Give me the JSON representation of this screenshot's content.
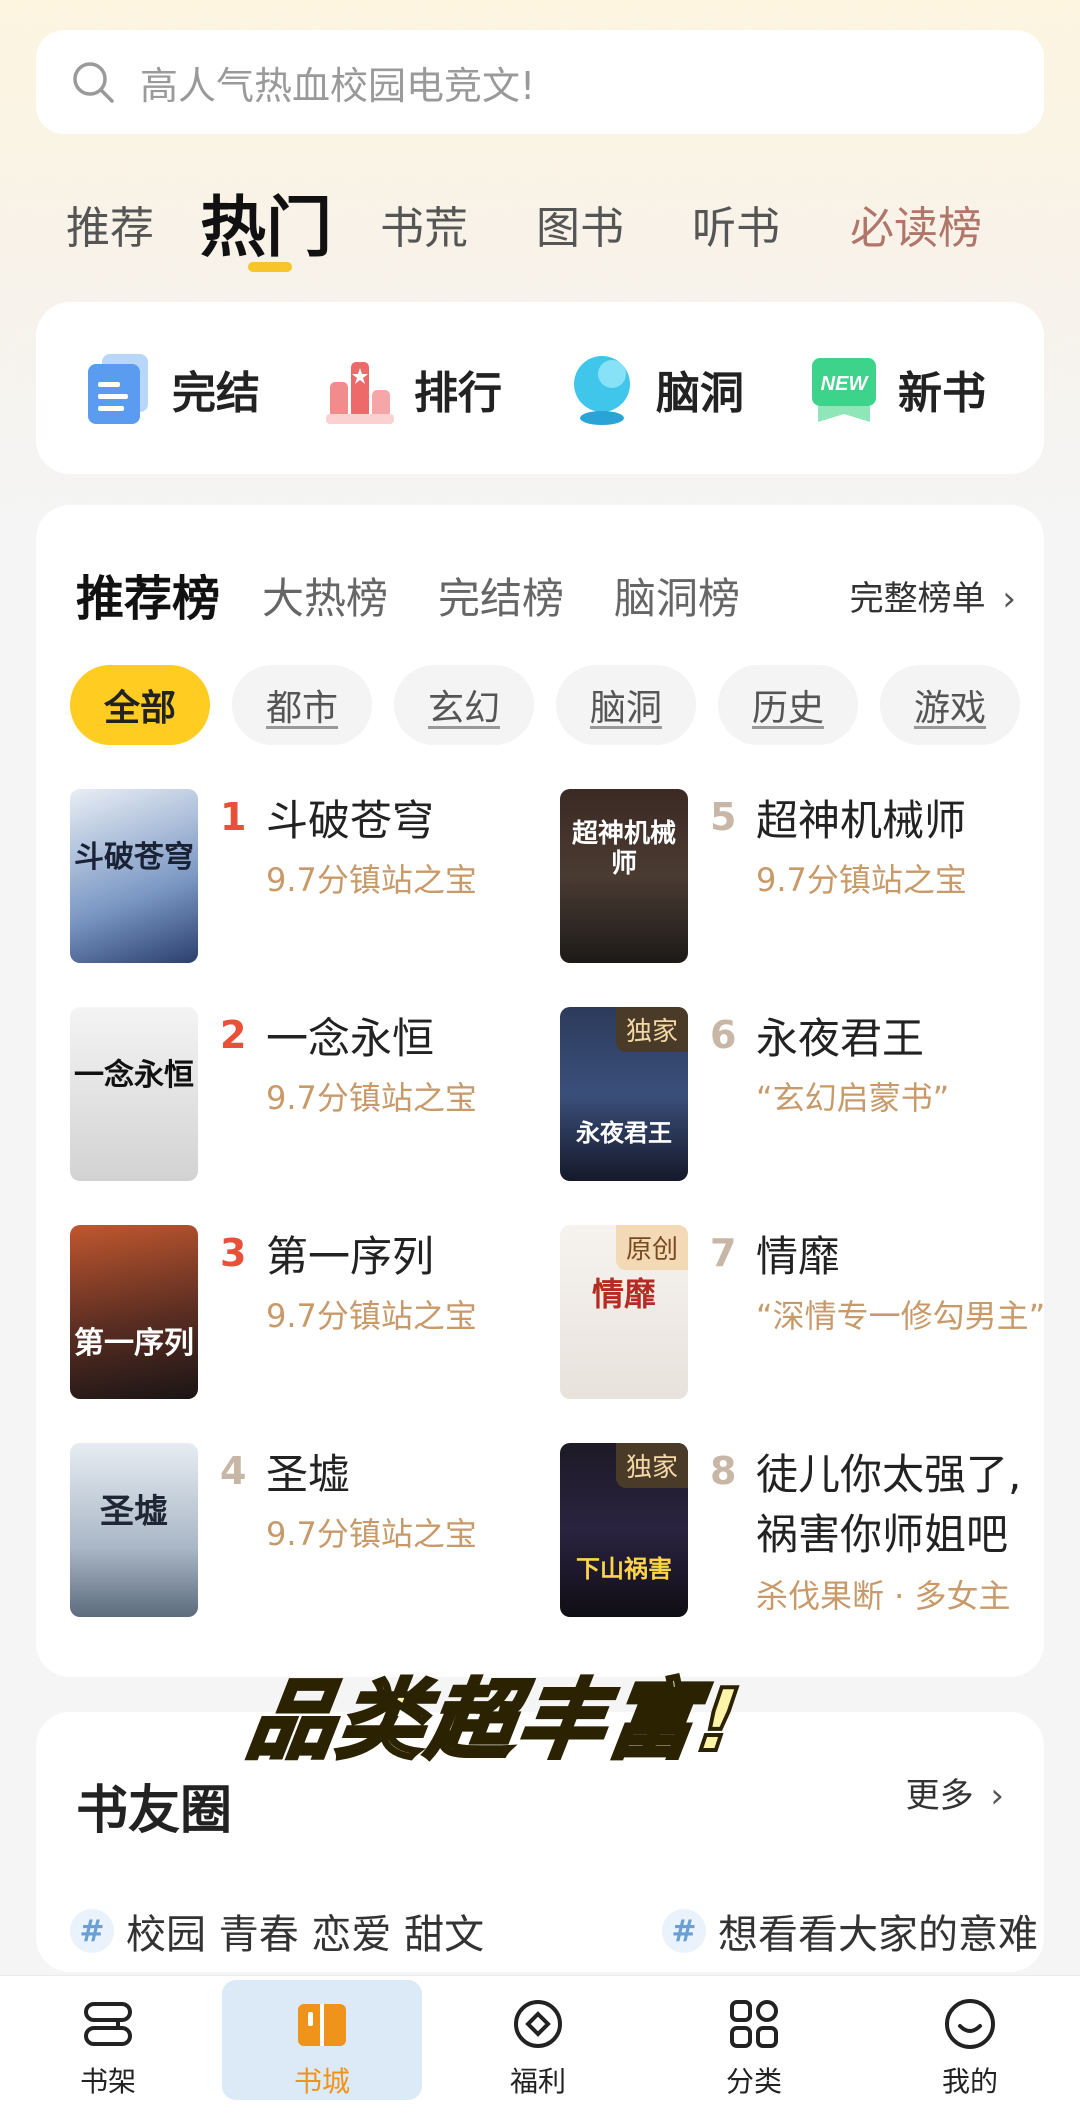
{
  "search": {
    "placeholder": "高人气热血校园电竞文!"
  },
  "top_tabs": [
    {
      "label": "推荐",
      "active": false
    },
    {
      "label": "热门",
      "active": true
    },
    {
      "label": "书荒",
      "active": false
    },
    {
      "label": "图书",
      "active": false
    },
    {
      "label": "听书",
      "active": false
    },
    {
      "label": "必读榜",
      "active": false
    }
  ],
  "shortcuts": [
    {
      "label": "完结",
      "icon": "document-icon"
    },
    {
      "label": "排行",
      "icon": "podium-icon"
    },
    {
      "label": "脑洞",
      "icon": "crystal-ball-icon"
    },
    {
      "label": "新书",
      "icon": "new-badge-icon",
      "badge": "NEW"
    }
  ],
  "ranking": {
    "tabs": [
      "推荐榜",
      "大热榜",
      "完结榜",
      "脑洞榜"
    ],
    "full_list": "完整榜单",
    "chips": [
      "全部",
      "都市",
      "玄幻",
      "脑洞",
      "历史",
      "游戏"
    ],
    "books": [
      {
        "rank": "1",
        "title": "斗破苍穹",
        "sub": "9.7分镇站之宝",
        "cover_text": "斗破苍穹"
      },
      {
        "rank": "2",
        "title": "一念永恒",
        "sub": "9.7分镇站之宝",
        "cover_text": "一念永恒"
      },
      {
        "rank": "3",
        "title": "第一序列",
        "sub": "9.7分镇站之宝",
        "cover_text": "第一序列"
      },
      {
        "rank": "4",
        "title": "圣墟",
        "sub": "9.7分镇站之宝",
        "cover_text": "圣墟"
      },
      {
        "rank": "5",
        "title": "超神机械师",
        "sub": "9.7分镇站之宝",
        "cover_text": "超神机械师"
      },
      {
        "rank": "6",
        "title": "永夜君王",
        "sub": "“玄幻启蒙书”",
        "cover_text": "永夜君王",
        "badge": "独家"
      },
      {
        "rank": "7",
        "title": "情靡",
        "sub": "“深情专一修勾男主”",
        "cover_text": "情靡",
        "badge": "原创"
      },
      {
        "rank": "8",
        "title": "徒儿你太强了,",
        "title2": "祸害你师姐吧",
        "sub": "杀伐果断 · 多女主",
        "cover_text": "下山祸害",
        "badge": "独家"
      }
    ]
  },
  "banner": "品类超丰富!",
  "friends": {
    "title": "书友圈",
    "more": "更多",
    "topics": [
      "校园 青春 恋爱 甜文",
      "想看看大家的意难"
    ]
  },
  "bottom_nav": [
    {
      "label": "书架",
      "icon": "bookshelf-icon",
      "active": false
    },
    {
      "label": "书城",
      "icon": "book-open-icon",
      "active": true
    },
    {
      "label": "福利",
      "icon": "gift-coin-icon",
      "active": false
    },
    {
      "label": "分类",
      "icon": "grid-icon",
      "active": false
    },
    {
      "label": "我的",
      "icon": "smile-icon",
      "active": false
    }
  ],
  "colors": {
    "accent": "#ffcc22",
    "rank_red": "#e8503a",
    "rank_gray": "#c8b6a6",
    "sub_gold": "#c89a6a",
    "nav_active": "#f0931a"
  }
}
